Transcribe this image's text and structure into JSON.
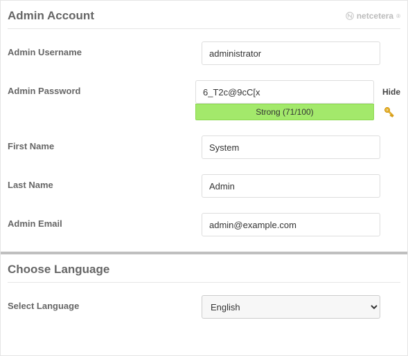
{
  "admin_section": {
    "title": "Admin Account",
    "brand": "netcetera",
    "username": {
      "label": "Admin Username",
      "value": "administrator"
    },
    "password": {
      "label": "Admin Password",
      "value": "6_T2c@9cC[x",
      "hide_label": "Hide",
      "strength_label": "Strong (71/100)"
    },
    "first_name": {
      "label": "First Name",
      "value": "System"
    },
    "last_name": {
      "label": "Last Name",
      "value": "Admin"
    },
    "email": {
      "label": "Admin Email",
      "value": "admin@example.com"
    }
  },
  "language_section": {
    "title": "Choose Language",
    "select": {
      "label": "Select Language",
      "value": "English"
    }
  }
}
